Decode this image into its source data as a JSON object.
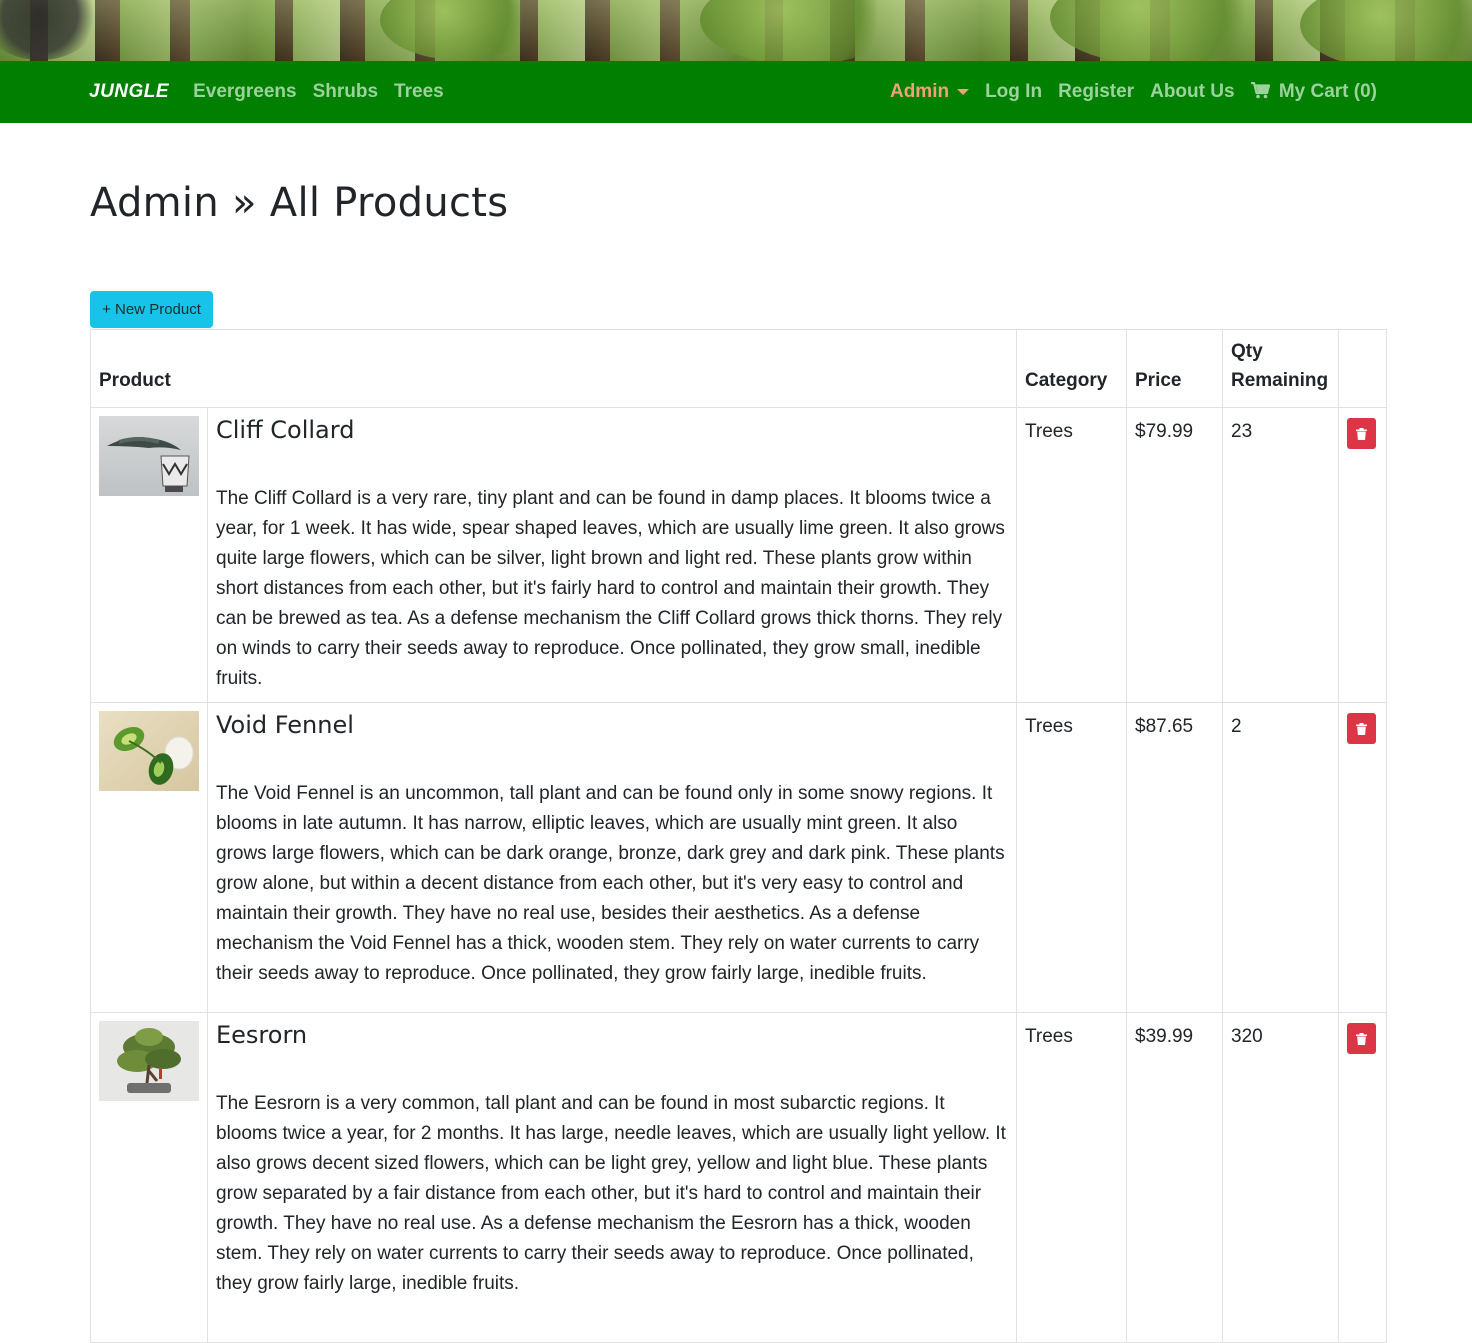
{
  "navbar": {
    "brand": "JUNGLE",
    "left_links": [
      "Evergreens",
      "Shrubs",
      "Trees"
    ],
    "admin_label": "Admin",
    "login_label": "Log In",
    "register_label": "Register",
    "about_label": "About Us",
    "cart_label": "My Cart (0)",
    "bg_color": "#007f00",
    "link_color": "#9cd29c",
    "admin_color": "#f4a07a"
  },
  "page": {
    "title": "Admin » All Products",
    "new_product_label": "+ New Product"
  },
  "table": {
    "headers": {
      "product": "Product",
      "category": "Category",
      "price": "Price",
      "qty": "Qty Remaining"
    },
    "rows": [
      {
        "name": "Cliff Collard",
        "description": "The Cliff Collard is a very rare, tiny plant and can be found in damp places. It blooms twice a year, for 1 week. It has wide, spear shaped leaves, which are usually lime green. It also grows quite large flowers, which can be silver, light brown and light red. These plants grow within short distances from each other, but it's fairly hard to control and maintain their growth. They can be brewed as tea. As a defense mechanism the Cliff Collard grows thick thorns. They rely on winds to carry their seeds away to reproduce. Once pollinated, they grow small, inedible fruits.",
        "category": "Trees",
        "price": "$79.99",
        "qty": "23"
      },
      {
        "name": "Void Fennel",
        "description": "The Void Fennel is an uncommon, tall plant and can be found only in some snowy regions. It blooms in late autumn. It has narrow, elliptic leaves, which are usually mint green. It also grows large flowers, which can be dark orange, bronze, dark grey and dark pink. These plants grow alone, but within a decent distance from each other, but it's very easy to control and maintain their growth. They have no real use, besides their aesthetics. As a defense mechanism the Void Fennel has a thick, wooden stem. They rely on water currents to carry their seeds away to reproduce. Once pollinated, they grow fairly large, inedible fruits.",
        "category": "Trees",
        "price": "$87.65",
        "qty": "2"
      },
      {
        "name": "Eesrorn",
        "description": "The Eesrorn is a very common, tall plant and can be found in most subarctic regions. It blooms twice a year, for 2 months. It has large, needle leaves, which are usually light yellow. It also grows decent sized flowers, which can be light grey, yellow and light blue. These plants grow separated by a fair distance from each other, but it's hard to control and maintain their growth. They have no real use. As a defense mechanism the Eesrorn has a thick, wooden stem. They rely on water currents to carry their seeds away to reproduce. Once pollinated, they grow fairly large, inedible fruits.",
        "category": "Trees",
        "price": "$39.99",
        "qty": "320"
      }
    ]
  },
  "icons": {
    "cart": "shopping-cart-icon",
    "delete": "trash-icon",
    "caret": "caret-down-icon"
  },
  "colors": {
    "new_button": "#17c3e8",
    "delete_button": "#dc3545"
  }
}
